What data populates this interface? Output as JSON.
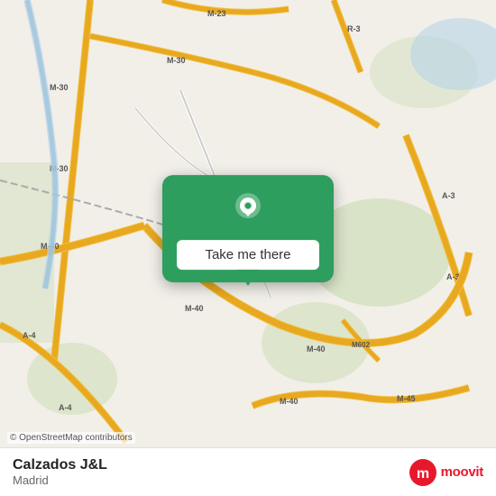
{
  "map": {
    "attribution": "© OpenStreetMap contributors"
  },
  "popup": {
    "button_label": "Take me there",
    "pin_icon": "location-pin"
  },
  "bottom_bar": {
    "location_name": "Calzados J&L",
    "location_city": "Madrid",
    "logo_text": "moovit"
  }
}
